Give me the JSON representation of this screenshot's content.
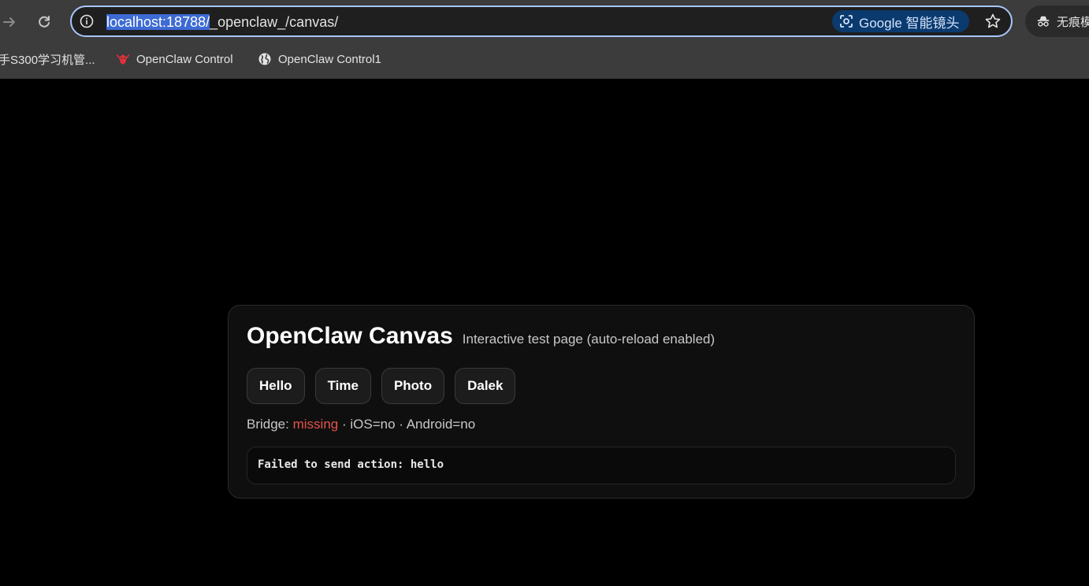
{
  "browser": {
    "url_selected": "localhost:18788/",
    "url_rest": "_openclaw_/canvas/",
    "lens_label": "Google 智能镜头",
    "incognito_label": "无痕模式",
    "bookmarks": [
      {
        "label": "手S300学习机管..."
      },
      {
        "label": "OpenClaw Control"
      },
      {
        "label": "OpenClaw Control1"
      }
    ]
  },
  "page": {
    "title": "OpenClaw Canvas",
    "subtitle": "Interactive test page (auto-reload enabled)",
    "buttons": [
      {
        "label": "Hello"
      },
      {
        "label": "Time"
      },
      {
        "label": "Photo"
      },
      {
        "label": "Dalek"
      }
    ],
    "status": {
      "bridge_label": "Bridge:",
      "bridge_value": "missing",
      "ios": "· iOS=no",
      "android": "· Android=no"
    },
    "log": "Failed to send action: hello"
  },
  "colors": {
    "background": "#000000",
    "card": "#0f0f0f",
    "missing": "#e5534b",
    "selection": "#3d6bd4"
  }
}
